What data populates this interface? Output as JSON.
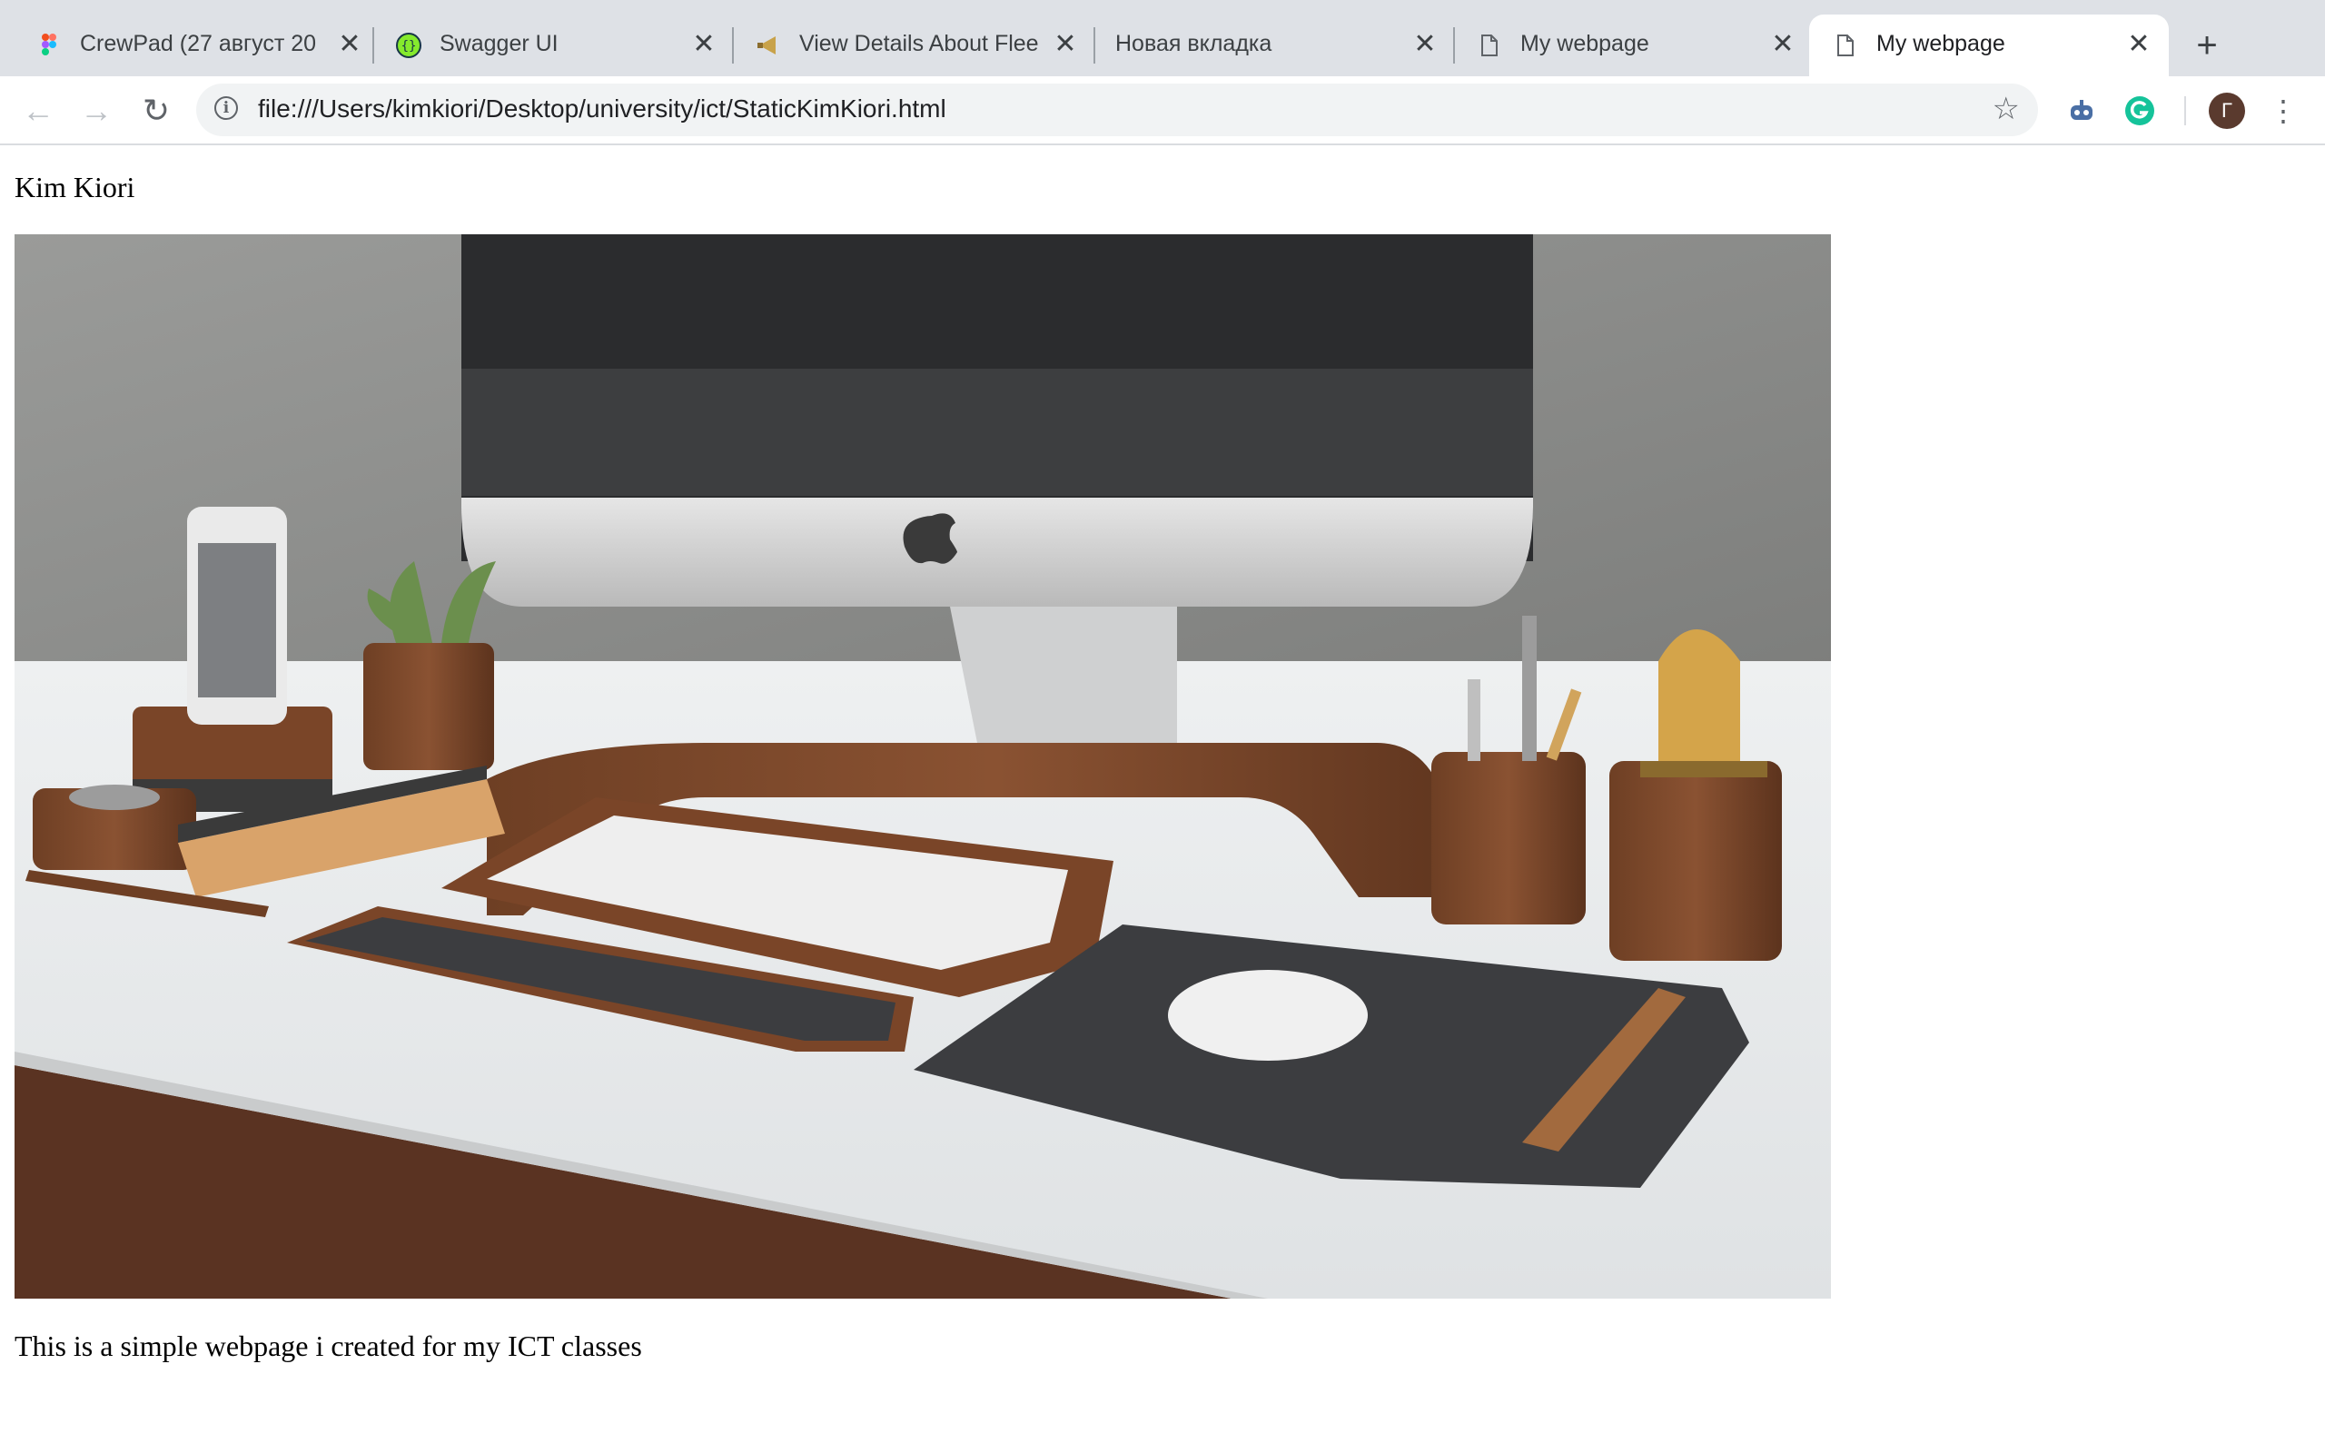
{
  "browser": {
    "tabs": [
      {
        "title": "CrewPad (27 август 20",
        "favicon": "figma-icon",
        "active": false
      },
      {
        "title": "Swagger UI",
        "favicon": "swagger-icon",
        "active": false
      },
      {
        "title": "View Details About Flee",
        "favicon": "megaphone-icon",
        "active": false
      },
      {
        "title": "Новая вкладка",
        "favicon": "",
        "active": false
      },
      {
        "title": "My webpage",
        "favicon": "document-icon",
        "active": false
      },
      {
        "title": "My webpage",
        "favicon": "document-icon",
        "active": true
      }
    ],
    "close_glyph": "✕",
    "new_tab_glyph": "+",
    "address_bar": {
      "url": "file:///Users/kimkiori/Desktop/university/ict/StaticKimKiori.html",
      "info_glyph": "i",
      "bookmark_glyph": "☆"
    },
    "nav": {
      "back_glyph": "←",
      "forward_glyph": "→",
      "reload_glyph": "↻"
    },
    "profile_initial": "Г",
    "menu_glyph": "⋮"
  },
  "page": {
    "heading": "Kim Kiori",
    "image_alt": "Desk setup with iMac on wooden stand, keyboard, mouse and wooden accessories",
    "caption": "This is a simple webpage i created for my ICT classes"
  }
}
